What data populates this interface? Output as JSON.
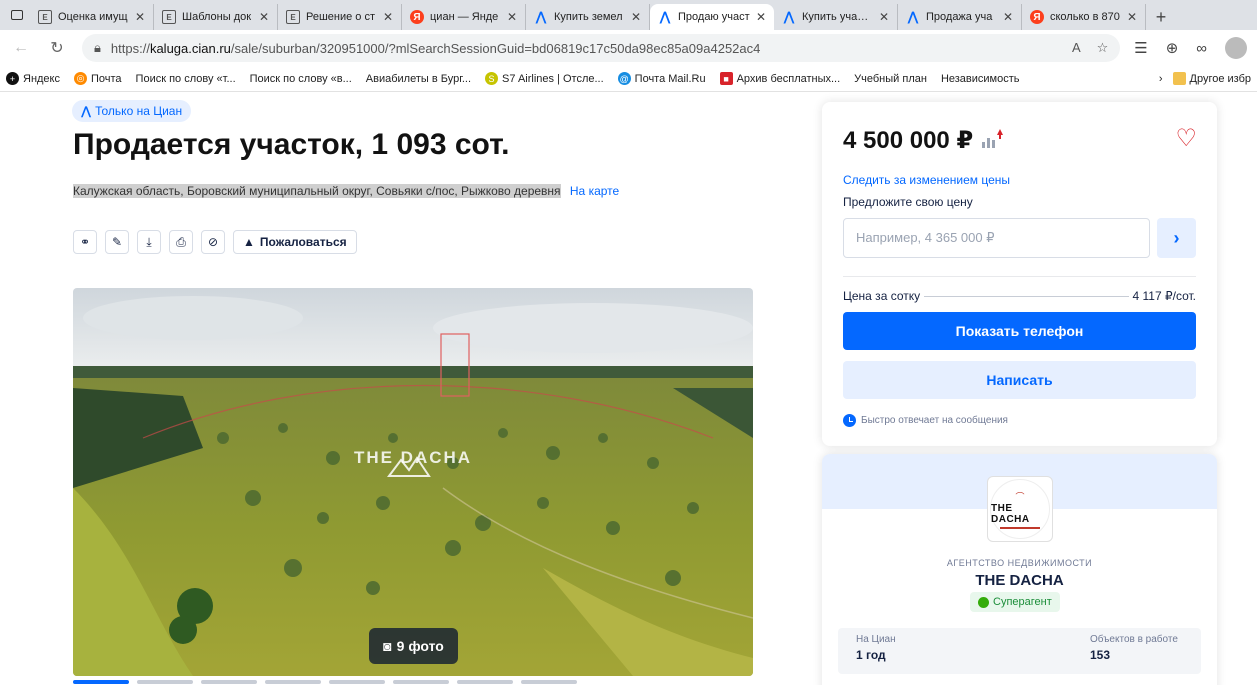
{
  "browser": {
    "tabs": [
      {
        "label": "Оценка имущ",
        "icon": "doc-icon"
      },
      {
        "label": "Шаблоны док",
        "icon": "doc-icon"
      },
      {
        "label": "Решение о ст",
        "icon": "doc-icon"
      },
      {
        "label": "циан — Янде",
        "icon": "yandex-icon"
      },
      {
        "label": "Купить земел",
        "icon": "cian-icon"
      },
      {
        "label": "Продаю участ",
        "icon": "cian-icon"
      },
      {
        "label": "Купить участо",
        "icon": "cian-icon"
      },
      {
        "label": "Продажа уча",
        "icon": "cian-icon"
      },
      {
        "label": "сколько в 870",
        "icon": "yandex-icon"
      }
    ],
    "active_tab": 5,
    "url_host": "kaluga.cian.ru",
    "url_prefix": "https://",
    "url_path": "/sale/suburban/320951000/?mlSearchSessionGuid=bd06819c17c50da98ec85a09a4252ac4",
    "bookmarks": [
      {
        "label": "Яндекс",
        "icon": "black"
      },
      {
        "label": "Почта",
        "icon": "orange"
      },
      {
        "label": "Поиск по слову «т...",
        "icon": "page"
      },
      {
        "label": "Поиск по слову «в...",
        "icon": "page"
      },
      {
        "label": "Авиабилеты в Бург...",
        "icon": "page"
      },
      {
        "label": "S7 Airlines | Отсле...",
        "icon": "yel"
      },
      {
        "label": "Почта Mail.Ru",
        "icon": "mail"
      },
      {
        "label": "Архив бесплатных...",
        "icon": "red"
      },
      {
        "label": "Учебный план",
        "icon": "page"
      },
      {
        "label": "Независимость",
        "icon": "page"
      }
    ],
    "other_bookmarks": "Другое избр"
  },
  "listing": {
    "badge": "Только на Циан",
    "title": "Продается участок, 1 093 сот.",
    "address": "Калужская область, Боровский муниципальный округ, Совьяки с/пос, Рыжково деревня",
    "map_link": "На карте",
    "complain": "Пожаловаться",
    "photo_count": "9 фото",
    "watermark": "THE DACHA"
  },
  "price_card": {
    "price": "4 500 000 ₽",
    "follow": "Следить за изменением цены",
    "offer_label": "Предложите свою цену",
    "offer_placeholder": "Например, 4 365 000 ₽",
    "per_sotka_label": "Цена за сотку",
    "per_sotka_value": "4 117 ₽/сот.",
    "show_phone": "Показать телефон",
    "write": "Написать",
    "fast_reply": "Быстро отвечает на сообщения"
  },
  "agent": {
    "logo_text": "THE DACHA",
    "type": "АГЕНТСТВО НЕДВИЖИМОСТИ",
    "name": "THE DACHA",
    "badge": "Суперагент",
    "stats": [
      {
        "label": "На Циан",
        "value": "1 год"
      },
      {
        "label": "Объектов в работе",
        "value": "153"
      }
    ]
  },
  "colors": {
    "accent": "#0468ff",
    "accent_light": "#e6efff",
    "favorite": "#d8232a",
    "superagent": "#34ac0a"
  }
}
